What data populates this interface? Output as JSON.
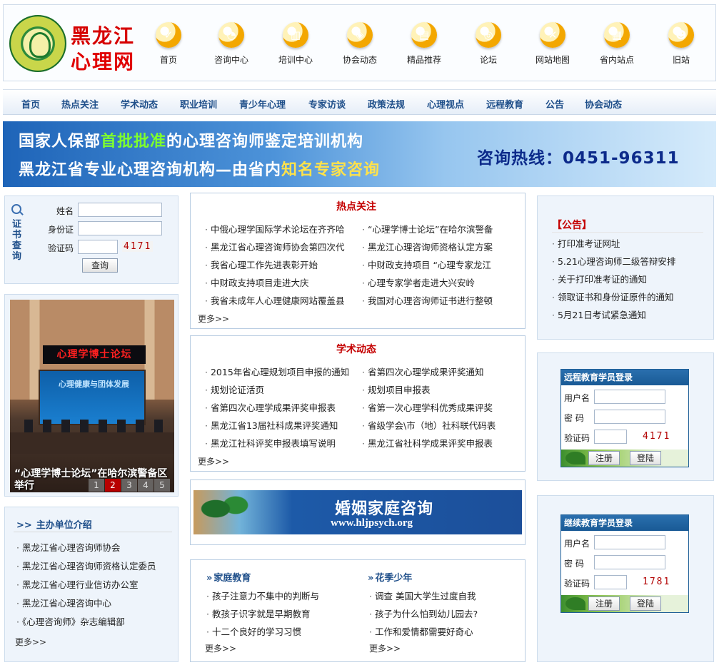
{
  "logo": {
    "line1": "黑龙江",
    "line2": "心理网"
  },
  "top_nav": [
    {
      "label": "首页",
      "icon": "home-icon",
      "glyph": "✓"
    },
    {
      "label": "咨询中心",
      "icon": "chart-pie-icon",
      "glyph": "◔"
    },
    {
      "label": "培训中心",
      "icon": "bar-chart-icon",
      "glyph": "▥"
    },
    {
      "label": "协会动态",
      "icon": "shopping-bag-icon",
      "glyph": "◈"
    },
    {
      "label": "精品推荐",
      "icon": "document-icon",
      "glyph": "▤"
    },
    {
      "label": "论坛",
      "icon": "coins-icon",
      "glyph": "◎"
    },
    {
      "label": "网站地图",
      "icon": "tools-icon",
      "glyph": "✕"
    },
    {
      "label": "省内站点",
      "icon": "server-icon",
      "glyph": "▦"
    },
    {
      "label": "旧站",
      "icon": "users-icon",
      "glyph": "☻"
    }
  ],
  "main_nav": [
    "首页",
    "热点关注",
    "学术动态",
    "职业培训",
    "青少年心理",
    "专家访谈",
    "政策法规",
    "心理视点",
    "远程教育",
    "公告",
    "协会动态"
  ],
  "banner": {
    "line1_a": "国家人保部",
    "line1_highlight": "首批批准",
    "line1_b": "的心理咨询师鉴定培训机构",
    "line2_a": "黑龙江省专业心理咨询机构—由省内",
    "line2_highlight": "知名专家咨询",
    "hotline_label": "咨询热线：",
    "hotline_number": "0451-96311"
  },
  "cert_query": {
    "side_label": "证书查询",
    "name_label": "姓名",
    "id_label": "身份证",
    "code_label": "验证码",
    "captcha": "4171",
    "button": "查询"
  },
  "photo": {
    "screen_text": "心理学博士论坛",
    "projector_text": "心理健康与团体发展",
    "caption": "“心理学博士论坛”在哈尔滨警备区举行",
    "pages": [
      "1",
      "2",
      "3",
      "4",
      "5"
    ],
    "active_page": 2
  },
  "sponsors": {
    "title": "主办单位介绍",
    "items": [
      "黑龙江省心理咨询师协会",
      "黑龙江省心理咨询师资格认定委员",
      "黑龙江省心理行业信访办公室",
      "黑龙江省心理咨询中心",
      "《心理咨询师》杂志编辑部"
    ],
    "more": "更多>>"
  },
  "hot": {
    "title": "热点关注",
    "left": [
      "中俄心理学国际学术论坛在齐齐哈",
      "黑龙江省心理咨询师协会第四次代",
      "我省心理工作先进表彰开始",
      "中财政支持项目走进大庆",
      "我省未成年人心理健康网站覆盖县"
    ],
    "right": [
      "“心理学博士论坛”在哈尔滨警备",
      "黑龙江心理咨询师资格认定方案",
      "中财政支持项目 “心理专家龙江",
      "心理专家学者走进大兴安岭",
      "我国对心理咨询师证书进行整顿"
    ],
    "more": "更多>>"
  },
  "academic": {
    "title": "学术动态",
    "left": [
      "2015年省心理规划项目申报的通知",
      "规划论证活页",
      "省第四次心理学成果评奖申报表",
      "黑龙江省13届社科成果评奖通知",
      "黑龙江社科评奖申报表填写说明"
    ],
    "right": [
      "省第四次心理学成果评奖通知",
      "规划项目申报表",
      "省第一次心理学科优秀成果评奖",
      "省级学会\\市（地）社科联代码表",
      "黑龙江省社科学成果评奖申报表"
    ],
    "more": "更多>>"
  },
  "marriage_ad": {
    "title": "婚姻家庭咨询",
    "url": "www.hljpsych.org"
  },
  "family": {
    "left_title": "家庭教育",
    "left": [
      "孩子注意力不集中的判断与",
      "教孩子识字就是早期教育",
      "十二个良好的学习习惯"
    ],
    "right_title": "花季少年",
    "right": [
      "调查 美国大学生过度自我",
      "孩子为什么怕到幼儿园去?",
      "工作和爱情都需要好奇心"
    ],
    "more": "更多>>"
  },
  "notice": {
    "title": "【公告】",
    "items": [
      "打印准考证网址",
      "5.21心理咨询师二级答辩安排",
      "关于打印准考证的通知",
      "领取证书和身份证原件的通知",
      "5月21日考试紧急通知"
    ]
  },
  "remote_login": {
    "title": "远程教育学员登录",
    "user_label": "用户名",
    "pwd_label": "密 码",
    "code_label": "验证码",
    "captcha": "4171",
    "register": "注册",
    "login": "登陆"
  },
  "cont_login": {
    "title": "继续教育学员登录",
    "user_label": "用户名",
    "pwd_label": "密 码",
    "code_label": "验证码",
    "captcha": "1781",
    "register": "注册",
    "login": "登陆"
  },
  "colors": {
    "accent_red": "#c40000",
    "nav_blue": "#1f4f8a",
    "banner_green": "#7eff2e",
    "banner_yellow": "#ffe24a",
    "hotline_blue": "#0c2a8a"
  }
}
